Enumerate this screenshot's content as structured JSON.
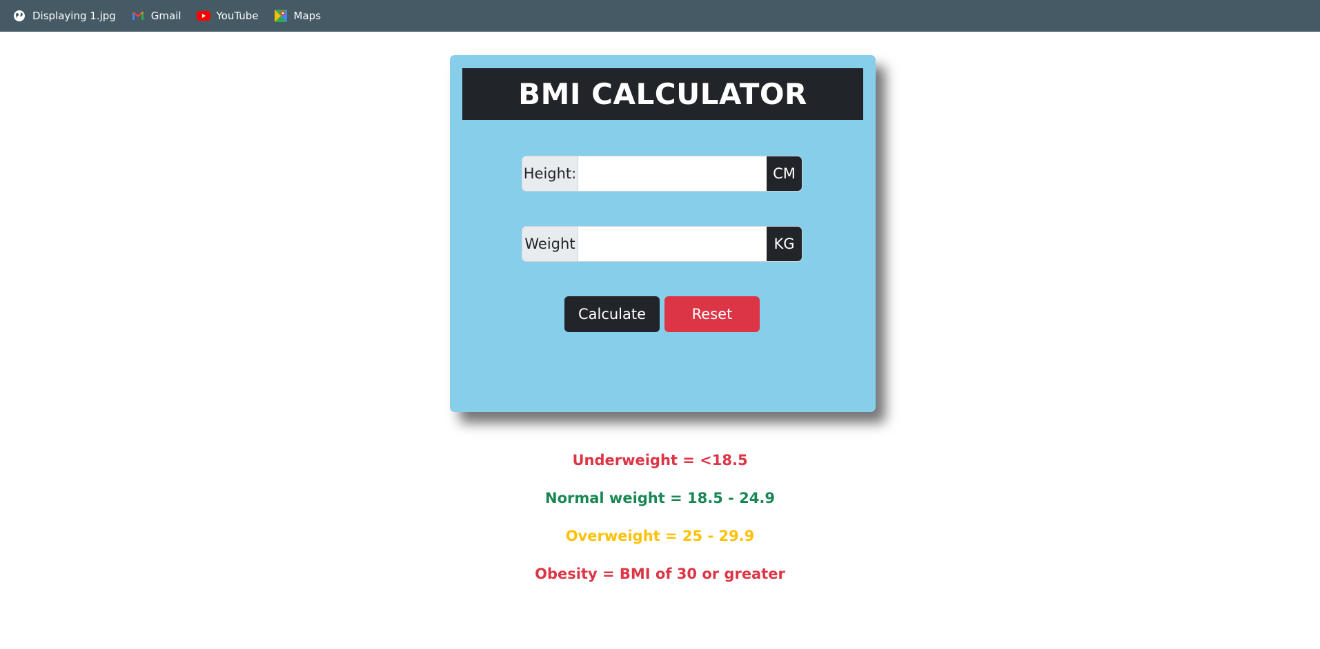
{
  "bookmarks": [
    {
      "label": "Displaying 1.jpg",
      "icon": "globe-icon"
    },
    {
      "label": "Gmail",
      "icon": "gmail-icon"
    },
    {
      "label": "YouTube",
      "icon": "youtube-icon"
    },
    {
      "label": "Maps",
      "icon": "maps-icon"
    }
  ],
  "calculator": {
    "title": "BMI CALCULATOR",
    "height": {
      "label": "Height:",
      "value": "",
      "unit": "CM"
    },
    "weight": {
      "label": "Weight",
      "value": "",
      "unit": "KG"
    },
    "calculate_label": "Calculate",
    "reset_label": "Reset"
  },
  "legend": [
    {
      "text": "Underweight = <18.5",
      "color": "#dc3545"
    },
    {
      "text": "Normal weight = 18.5 - 24.9",
      "color": "#198754"
    },
    {
      "text": "Overweight = 25 - 29.9",
      "color": "#ffc107"
    },
    {
      "text": "Obesity = BMI of 30 or greater",
      "color": "#dc3545"
    }
  ],
  "colors": {
    "bookmarks_bar": "#455a64",
    "card": "#87ceeb",
    "dark": "#212529",
    "danger": "#dc3545"
  }
}
